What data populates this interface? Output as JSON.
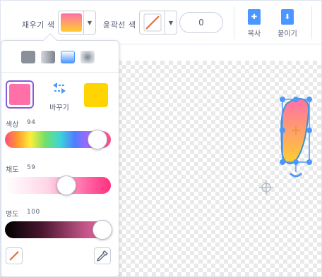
{
  "toolbar": {
    "fill_label": "채우기 색",
    "outline_label": "윤곽선 색",
    "outline_width_value": "0",
    "copy_label": "복사",
    "paste_label": "붙이기"
  },
  "popup": {
    "swap_label": "바꾸기",
    "hue_label": "색상",
    "hue_value": "94",
    "saturation_label": "채도",
    "saturation_value": "59",
    "brightness_label": "명도",
    "brightness_value": "100"
  },
  "slider_levels": {
    "hue": 0.94,
    "saturation": 0.59,
    "brightness": 1.0
  },
  "colors": {
    "accent": "#4c97ff",
    "selected_border": "#855cd6",
    "primary_swatch": "#ff6fa8",
    "secondary_swatch": "#ffd400"
  },
  "icons": [
    "chevron-down-icon",
    "no-stroke-icon",
    "copy-icon",
    "paste-icon",
    "swap-icon",
    "eyedropper-icon",
    "pen-icon",
    "crosshair-icon"
  ]
}
